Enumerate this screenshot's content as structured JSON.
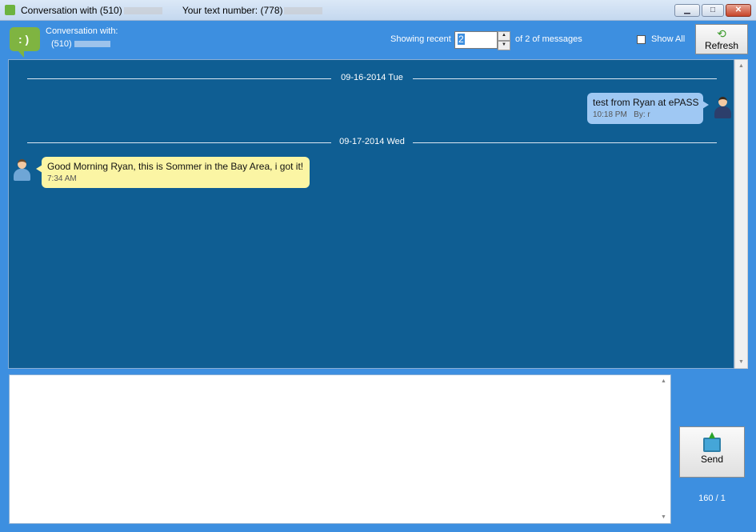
{
  "window": {
    "title_prefix": "Conversation with (510)",
    "title_middle": "Your text number: (778)"
  },
  "header": {
    "conversation_label": "Conversation with:",
    "conversation_number": "(510)",
    "showing_label": "Showing recent",
    "showing_value": "2",
    "of_label": "of  2 of messages",
    "show_all_label": "Show All",
    "show_all_checked": false,
    "refresh_label": "Refresh"
  },
  "messages": {
    "date1": "09-16-2014 Tue",
    "msg1_text": "test from Ryan at ePASS",
    "msg1_time": "10:18 PM",
    "msg1_by": "By: r",
    "date2": "09-17-2014 Wed",
    "msg2_text": "Good Morning Ryan, this is Sommer in the Bay Area, i got it!",
    "msg2_time": "7:34 AM"
  },
  "compose": {
    "value": "",
    "send_label": "Send",
    "counter": "160 / 1"
  }
}
